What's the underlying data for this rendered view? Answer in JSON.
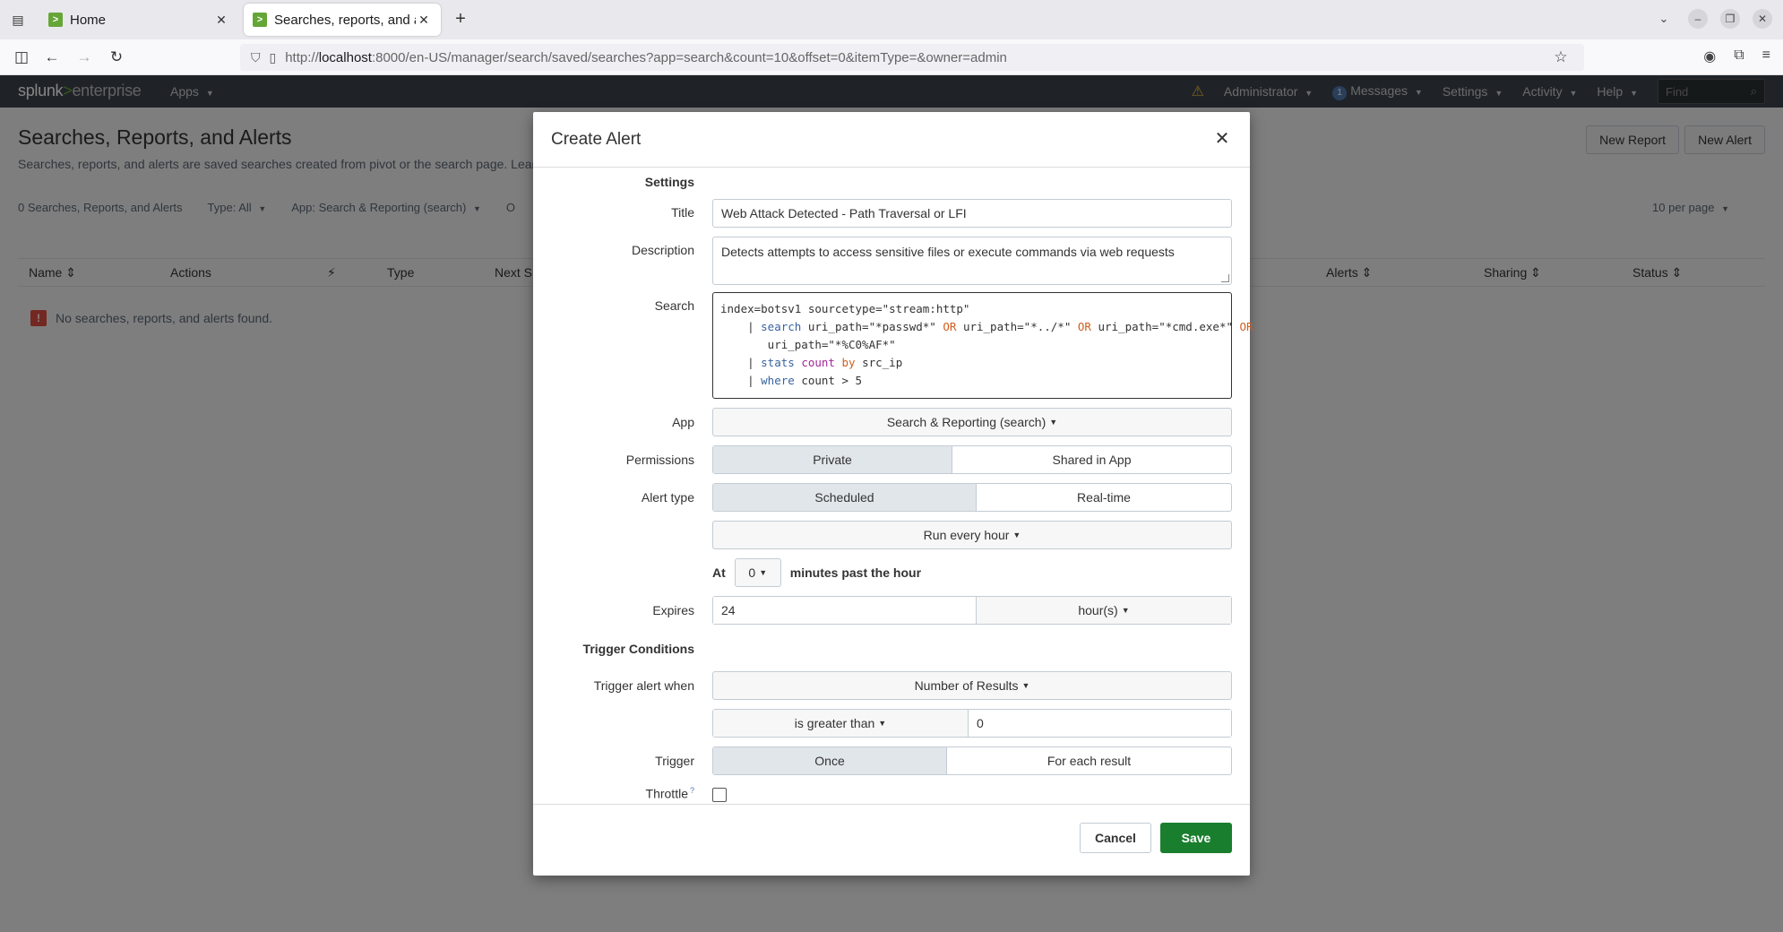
{
  "browser": {
    "tabs": [
      {
        "title": "Home",
        "close": "✕"
      },
      {
        "title": "Searches, reports, and alerts",
        "close": "✕"
      }
    ],
    "new_tab": "+",
    "url": {
      "prefix": "http://",
      "host": "localhost",
      "rest": ":8000/en-US/manager/search/saved/searches?app=search&count=10&offset=0&itemType=&owner=admin"
    }
  },
  "splunk_header": {
    "logo_main": "splunk",
    "logo_gt": ">",
    "logo_edition": "enterprise",
    "apps": "Apps",
    "user": "Administrator",
    "messages_count": "1",
    "messages": "Messages",
    "settings": "Settings",
    "activity": "Activity",
    "help": "Help",
    "find_placeholder": "Find"
  },
  "page": {
    "title": "Searches, Reports, and Alerts",
    "description": "Searches, reports, and alerts are saved searches created from pivot or the search page. Learn more",
    "new_report": "New Report",
    "new_alert": "New Alert",
    "count_label": "0 Searches, Reports, and Alerts",
    "type_filter": "Type: All",
    "app_filter": "App: Search & Reporting (search)",
    "owner_filter": "O",
    "per_page": "10 per page",
    "columns": [
      "Name",
      "Actions",
      "⚡",
      "Type",
      "Next S",
      "Alerts",
      "Sharing",
      "Status"
    ],
    "no_results": "No searches, reports, and alerts found."
  },
  "modal": {
    "title": "Create Alert",
    "close": "✕",
    "settings_heading": "Settings",
    "title_label": "Title",
    "title_value": "Web Attack Detected - Path Traversal or LFI",
    "description_label": "Description",
    "description_value": "Detects attempts to access sensitive files or execute commands via web requests",
    "search_label": "Search",
    "search_lines": {
      "l1": "index=botsv1 sourcetype=\"stream:http\"",
      "l2_pre": "    | ",
      "l2_kw": "search",
      "l2_a": " uri_path=\"*passwd*\" ",
      "l2_or1": "OR",
      "l2_b": " uri_path=\"*../*\" ",
      "l2_or2": "OR",
      "l2_c": " uri_path=\"*cmd.exe*\" ",
      "l2_or3": "OR",
      "l3": "       uri_path=\"*%C0%AF*\"",
      "l4_pre": "    | ",
      "l4_kw": "stats",
      "l4_sp": " ",
      "l4_fn": "count",
      "l4_by": " by",
      "l4_rest": " src_ip",
      "l5_pre": "    | ",
      "l5_kw": "where",
      "l5_rest": " count > 5"
    },
    "app_label": "App",
    "app_value": "Search & Reporting (search)",
    "permissions_label": "Permissions",
    "permissions_options": [
      "Private",
      "Shared in App"
    ],
    "alert_type_label": "Alert type",
    "alert_type_options": [
      "Scheduled",
      "Real-time"
    ],
    "schedule_value": "Run every hour",
    "at_label": "At",
    "at_minutes": "0",
    "minutes_past": "minutes past the hour",
    "expires_label": "Expires",
    "expires_value": "24",
    "expires_unit": "hour(s)",
    "trigger_conditions_heading": "Trigger Conditions",
    "trigger_when_label": "Trigger alert when",
    "trigger_when_value": "Number of Results",
    "comparison_value": "is greater than",
    "threshold_value": "0",
    "trigger_label": "Trigger",
    "trigger_options": [
      "Once",
      "For each result"
    ],
    "throttle_label": "Throttle",
    "throttle_help": "?",
    "cancel": "Cancel",
    "save": "Save"
  }
}
